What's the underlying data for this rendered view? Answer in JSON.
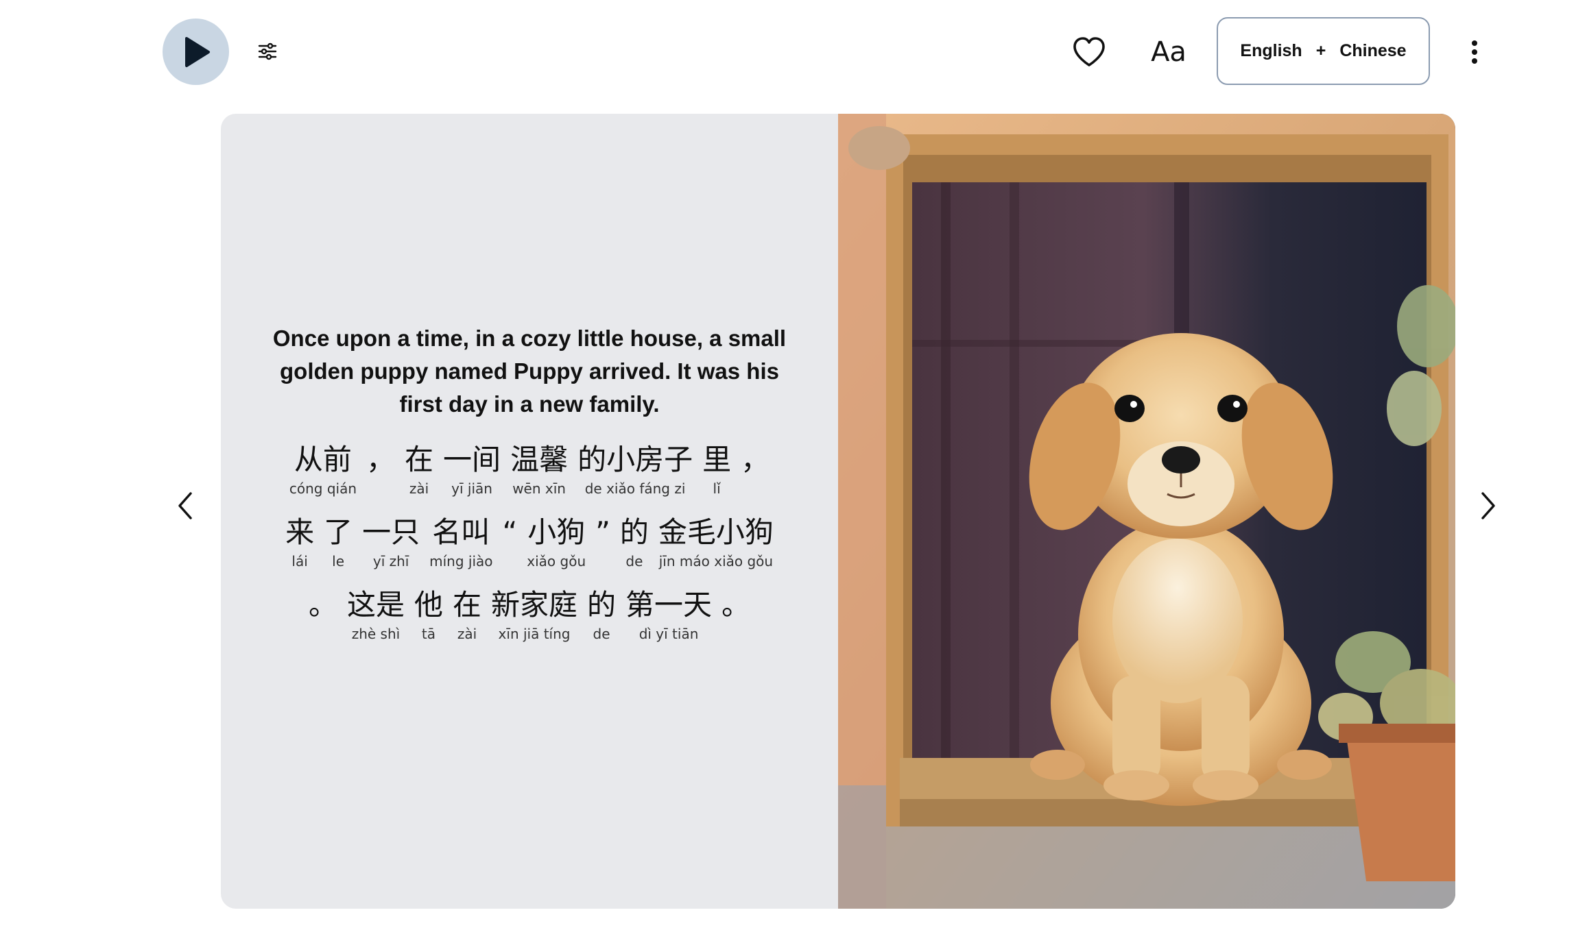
{
  "toolbar": {
    "play_icon": "play-icon",
    "settings_icon": "sliders-icon",
    "favorite_icon": "heart-icon",
    "font_size_label": "Aa",
    "language": {
      "primary": "English",
      "separator": "+",
      "secondary": "Chinese"
    },
    "more_icon": "kebab-menu-icon"
  },
  "navigation": {
    "prev_icon": "chevron-left-icon",
    "next_icon": "chevron-right-icon"
  },
  "page": {
    "english_text": "Once upon a time, in a cozy little house, a small golden puppy named Puppy arrived. It was his first day in a new family.",
    "chinese_lines": [
      [
        {
          "hanzi": "从前",
          "pinyin": "cóng qián"
        },
        {
          "hanzi": "，",
          "pinyin": ""
        },
        {
          "hanzi": "在",
          "pinyin": "zài"
        },
        {
          "hanzi": "一间",
          "pinyin": "yī jiān"
        },
        {
          "hanzi": "温馨",
          "pinyin": "wēn xīn"
        },
        {
          "hanzi": "的小房子",
          "pinyin": "de xiǎo fáng zi"
        },
        {
          "hanzi": "里",
          "pinyin": "lǐ"
        },
        {
          "hanzi": "，",
          "pinyin": ""
        }
      ],
      [
        {
          "hanzi": "来",
          "pinyin": "lái"
        },
        {
          "hanzi": "了",
          "pinyin": "le"
        },
        {
          "hanzi": "一只",
          "pinyin": "yī zhī"
        },
        {
          "hanzi": "名叫",
          "pinyin": "míng jiào"
        },
        {
          "hanzi": "“",
          "pinyin": ""
        },
        {
          "hanzi": "小狗",
          "pinyin": "xiǎo gǒu"
        },
        {
          "hanzi": "”",
          "pinyin": ""
        },
        {
          "hanzi": "的",
          "pinyin": "de"
        },
        {
          "hanzi": "金毛小狗",
          "pinyin": "jīn máo xiǎo gǒu"
        }
      ],
      [
        {
          "hanzi": "。",
          "pinyin": ""
        },
        {
          "hanzi": "这是",
          "pinyin": "zhè shì"
        },
        {
          "hanzi": "他",
          "pinyin": "tā"
        },
        {
          "hanzi": "在",
          "pinyin": "zài"
        },
        {
          "hanzi": "新家庭",
          "pinyin": "xīn jiā tíng"
        },
        {
          "hanzi": "的",
          "pinyin": "de"
        },
        {
          "hanzi": "第一天",
          "pinyin": "dì yī tiān"
        },
        {
          "hanzi": "。",
          "pinyin": ""
        }
      ]
    ],
    "illustration": "watercolor-golden-puppy-in-window"
  },
  "colors": {
    "play_button_bg": "#c9d6e3",
    "text_page_bg": "#e8e9ec",
    "lang_button_border": "#8b9bb0"
  }
}
